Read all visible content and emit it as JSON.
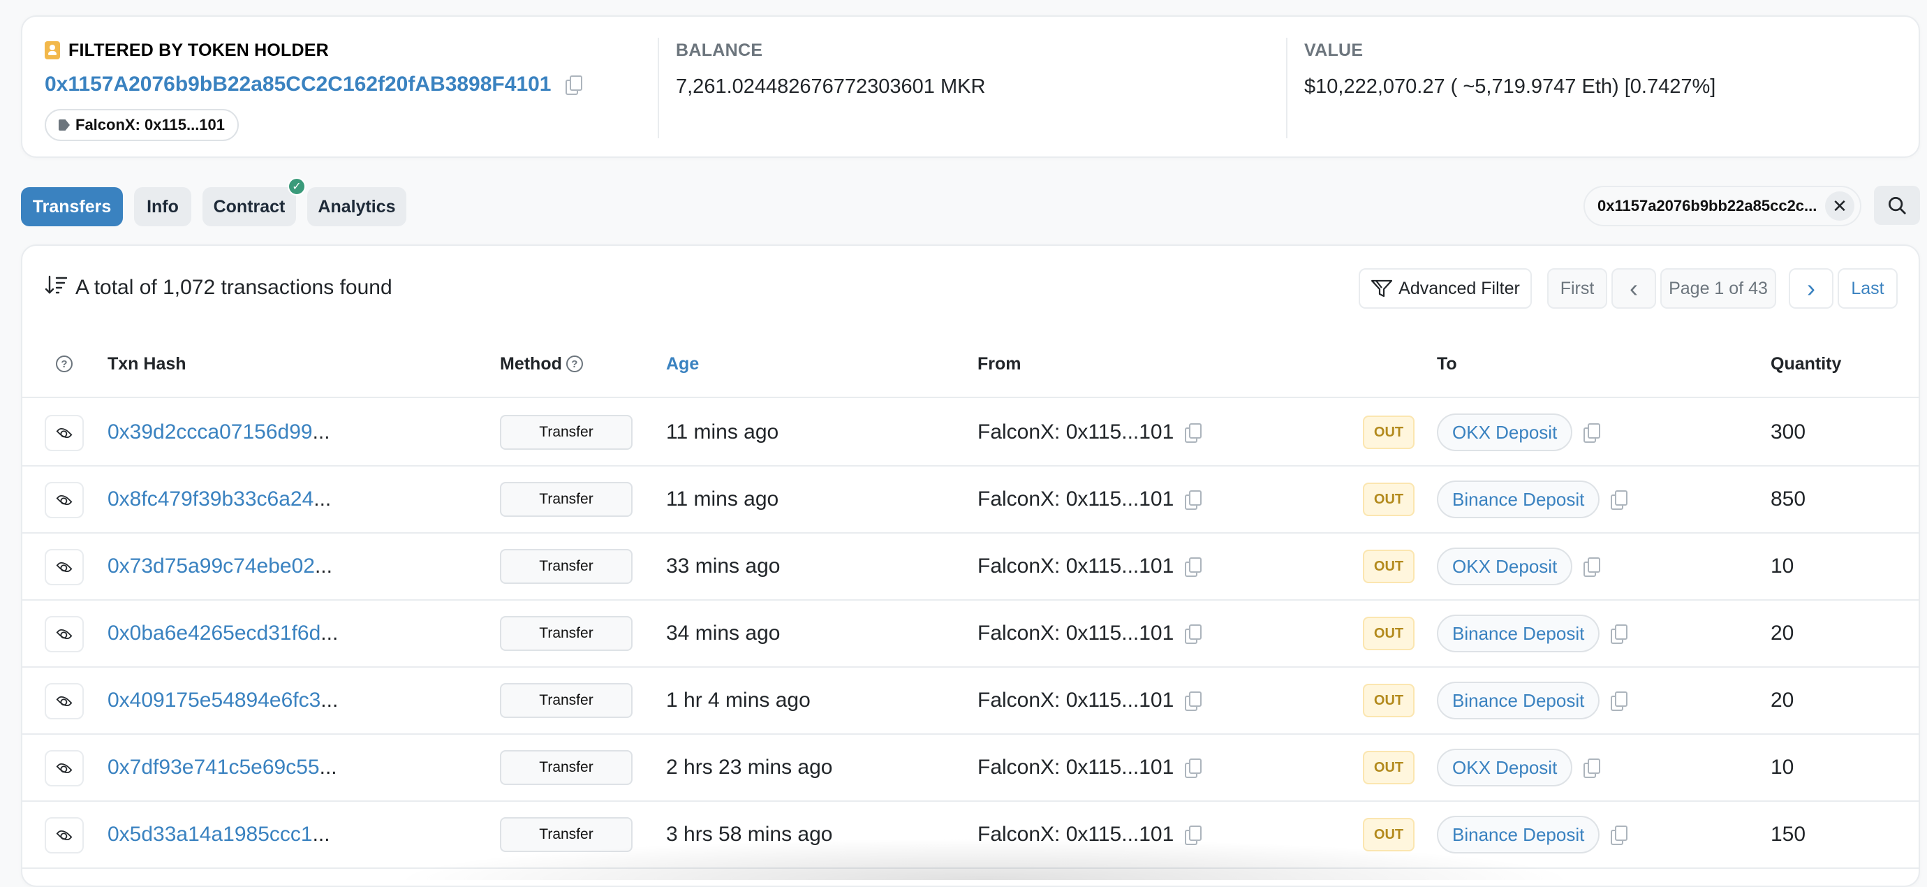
{
  "summary": {
    "filter_label": "FILTERED BY TOKEN HOLDER",
    "holder_address": "0x1157A2076b9bB22a85CC2C162f20fAB3898F4101",
    "name_tag": "FalconX: 0x115...101",
    "balance_title": "BALANCE",
    "balance_value": "7,261.024482676772303601 MKR",
    "value_title": "VALUE",
    "value_value": "$10,222,070.27 ( ~5,719.9747 Eth) [0.7427%]"
  },
  "tabs": [
    {
      "label": "Transfers",
      "active": true
    },
    {
      "label": "Info",
      "active": false
    },
    {
      "label": "Contract",
      "active": false,
      "verified": true
    },
    {
      "label": "Analytics",
      "active": false
    }
  ],
  "filter": {
    "value": "0x1157a2076b9bb22a85cc2c...",
    "clear_icon": "✕",
    "search_icon": "search-icon"
  },
  "table_header": {
    "total_text": "A total of 1,072 transactions found",
    "advanced_filter": "Advanced Filter",
    "first": "First",
    "prev": "‹",
    "page_info": "Page 1 of 43",
    "next": "›",
    "last": "Last"
  },
  "columns": {
    "txn_hash": "Txn Hash",
    "method": "Method",
    "age": "Age",
    "from": "From",
    "to": "To",
    "quantity": "Quantity"
  },
  "rows": [
    {
      "hash": "0x39d2ccca07156d99",
      "method": "Transfer",
      "age": "11 mins ago",
      "from": "FalconX: 0x115...101",
      "direction": "OUT",
      "to": "OKX Deposit",
      "quantity": "300"
    },
    {
      "hash": "0x8fc479f39b33c6a24",
      "method": "Transfer",
      "age": "11 mins ago",
      "from": "FalconX: 0x115...101",
      "direction": "OUT",
      "to": "Binance Deposit",
      "quantity": "850"
    },
    {
      "hash": "0x73d75a99c74ebe02",
      "method": "Transfer",
      "age": "33 mins ago",
      "from": "FalconX: 0x115...101",
      "direction": "OUT",
      "to": "OKX Deposit",
      "quantity": "10"
    },
    {
      "hash": "0x0ba6e4265ecd31f6d",
      "method": "Transfer",
      "age": "34 mins ago",
      "from": "FalconX: 0x115...101",
      "direction": "OUT",
      "to": "Binance Deposit",
      "quantity": "20"
    },
    {
      "hash": "0x409175e54894e6fc3",
      "method": "Transfer",
      "age": "1 hr 4 mins ago",
      "from": "FalconX: 0x115...101",
      "direction": "OUT",
      "to": "Binance Deposit",
      "quantity": "20"
    },
    {
      "hash": "0x7df93e741c5e69c55",
      "method": "Transfer",
      "age": "2 hrs 23 mins ago",
      "from": "FalconX: 0x115...101",
      "direction": "OUT",
      "to": "OKX Deposit",
      "quantity": "10"
    },
    {
      "hash": "0x5d33a14a1985ccc1",
      "method": "Transfer",
      "age": "3 hrs 58 mins ago",
      "from": "FalconX: 0x115...101",
      "direction": "OUT",
      "to": "Binance Deposit",
      "quantity": "150"
    }
  ],
  "ellipsis": "...",
  "colors": {
    "accent": "#3a82c0",
    "out_badge": "#b38a1d",
    "verified": "#3a9a7a",
    "holder_icon": "#f2b84b"
  }
}
